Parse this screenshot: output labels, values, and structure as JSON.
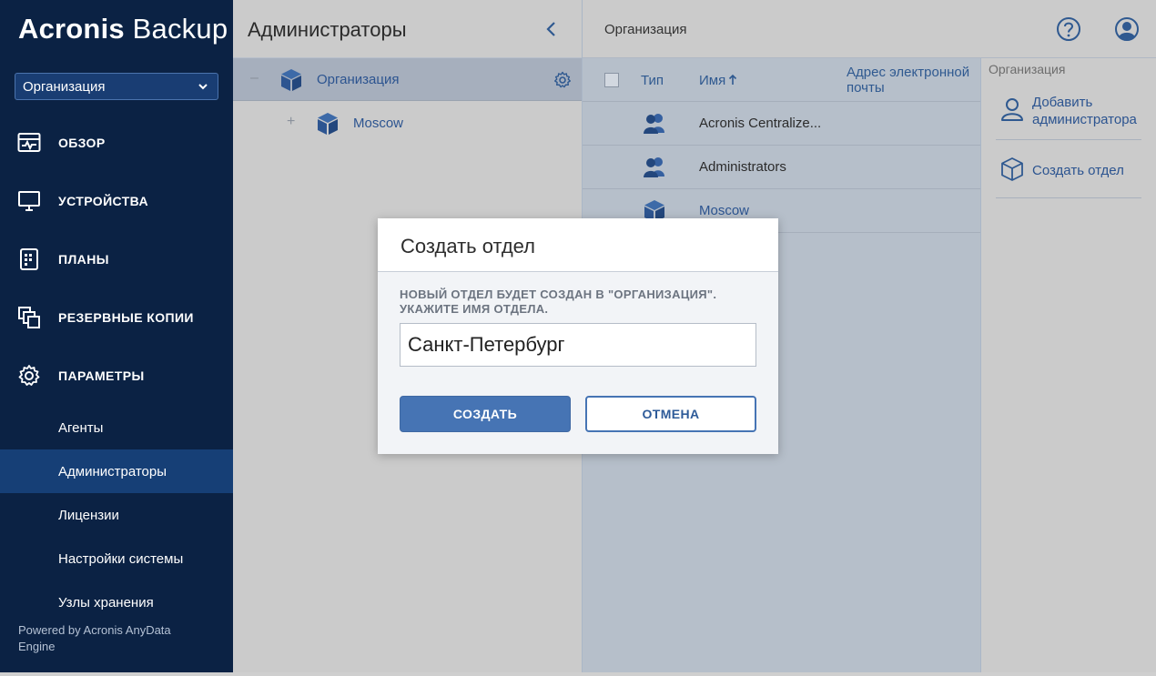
{
  "brand": {
    "part1": "Acronis",
    "part2": "Backup"
  },
  "org_selector": {
    "value": "Организация"
  },
  "nav": {
    "items": [
      {
        "label": "ОБЗОР",
        "icon": "dashboard-icon"
      },
      {
        "label": "УСТРОЙСТВА",
        "icon": "monitor-icon"
      },
      {
        "label": "ПЛАНЫ",
        "icon": "plans-icon"
      },
      {
        "label": "РЕЗЕРВНЫЕ КОПИИ",
        "icon": "backups-icon"
      },
      {
        "label": "ПАРАМЕТРЫ",
        "icon": "gear-icon"
      }
    ],
    "sub_items": [
      {
        "label": "Агенты"
      },
      {
        "label": "Администраторы",
        "active": true
      },
      {
        "label": "Лицензии"
      },
      {
        "label": "Настройки системы"
      },
      {
        "label": "Узлы хранения"
      }
    ],
    "powered_by": "Powered by Acronis AnyData Engine"
  },
  "tree_panel": {
    "title": "Администраторы",
    "nodes": [
      {
        "toggle": "–",
        "name": "Организация",
        "selected": true
      },
      {
        "toggle": "+",
        "name": "Moscow",
        "selected": false
      }
    ]
  },
  "content": {
    "breadcrumb": "Организация",
    "table": {
      "columns": {
        "type": "Тип",
        "name": "Имя",
        "email": "Адрес электронной почты"
      },
      "rows": [
        {
          "icon": "user-group-icon",
          "name": "Acronis Centralize..."
        },
        {
          "icon": "user-group-icon",
          "name": "Administrators"
        },
        {
          "icon": "cube-icon",
          "name": "Moscow"
        }
      ]
    }
  },
  "actions": {
    "title": "Организация",
    "items": [
      {
        "icon": "user-add-icon",
        "label": "Добавить администратора"
      },
      {
        "icon": "cube-outline-icon",
        "label": "Создать отдел"
      }
    ]
  },
  "modal": {
    "title": "Создать отдел",
    "message": "НОВЫЙ ОТДЕЛ БУДЕТ СОЗДАН В \"ОРГАНИЗАЦИЯ\". УКАЖИТЕ ИМЯ ОТДЕЛА.",
    "input_value": "Санкт-Петербург",
    "create_label": "СОЗДАТЬ",
    "cancel_label": "ОТМЕНА"
  },
  "colors": {
    "sidebar_bg": "#0b2244",
    "active_item": "#163f76",
    "accent": "#4674b4",
    "link": "#2c5490"
  }
}
